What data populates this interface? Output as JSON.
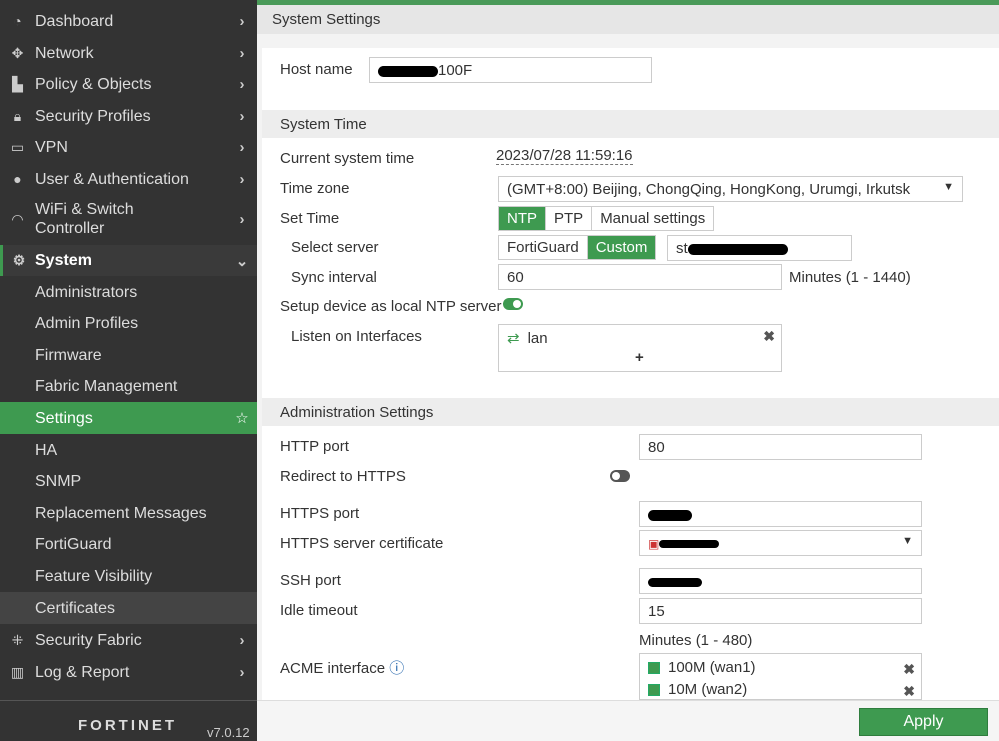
{
  "sidebar": {
    "items": [
      {
        "label": "Dashboard",
        "icon": "dashboard-icon"
      },
      {
        "label": "Network",
        "icon": "move-arrows-icon"
      },
      {
        "label": "Policy & Objects",
        "icon": "policy-icon"
      },
      {
        "label": "Security Profiles",
        "icon": "lock-icon"
      },
      {
        "label": "VPN",
        "icon": "laptop-icon"
      },
      {
        "label": "User & Authentication",
        "icon": "user-icon"
      },
      {
        "label": "WiFi & Switch Controller",
        "icon": "wifi-icon"
      },
      {
        "label": "System",
        "icon": "gear-icon"
      }
    ],
    "system_sub": [
      "Administrators",
      "Admin Profiles",
      "Firmware",
      "Fabric Management",
      "Settings",
      "HA",
      "SNMP",
      "Replacement Messages",
      "FortiGuard",
      "Feature Visibility",
      "Certificates"
    ],
    "bottom_items": [
      {
        "label": "Security Fabric",
        "icon": "security-fabric-icon"
      },
      {
        "label": "Log & Report",
        "icon": "chart-icon"
      }
    ],
    "logo": "FORTINET",
    "version": "v7.0.12"
  },
  "header": {
    "title": "System Settings"
  },
  "host": {
    "label": "Host name",
    "value": "100F"
  },
  "system_time": {
    "title": "System Time",
    "current_label": "Current system time",
    "current_value": "2023/07/28 11:59:16",
    "tz_label": "Time zone",
    "tz_value": "(GMT+8:00) Beijing, ChongQing, HongKong, Urumgi, Irkutsk",
    "set_time_label": "Set Time",
    "set_time_options": [
      "NTP",
      "PTP",
      "Manual settings"
    ],
    "set_time_selected": "NTP",
    "server_label": "Select server",
    "server_options": [
      "FortiGuard",
      "Custom"
    ],
    "server_selected": "Custom",
    "server_value": "st",
    "sync_label": "Sync interval",
    "sync_value": "60",
    "sync_unit": "Minutes (1 - 1440)",
    "ntp_server_label": "Setup device as local NTP server",
    "ntp_server_enabled": true,
    "listen_label": "Listen on Interfaces",
    "listen_interfaces": [
      "lan"
    ],
    "add": "+"
  },
  "admin": {
    "title": "Administration Settings",
    "http_label": "HTTP port",
    "http_value": "80",
    "redirect_label": "Redirect to HTTPS",
    "redirect_enabled": false,
    "https_label": "HTTPS port",
    "cert_label": "HTTPS server certificate",
    "ssh_label": "SSH port",
    "idle_label": "Idle timeout",
    "idle_value": "15",
    "idle_unit": "Minutes (1 - 480)",
    "acme_label": "ACME interface",
    "acme_interfaces": [
      "100M (wan1)",
      "10M (wan2)"
    ]
  },
  "footer": {
    "apply": "Apply"
  },
  "colors": {
    "accent": "#3e9a50",
    "sidebar": "#333333"
  }
}
